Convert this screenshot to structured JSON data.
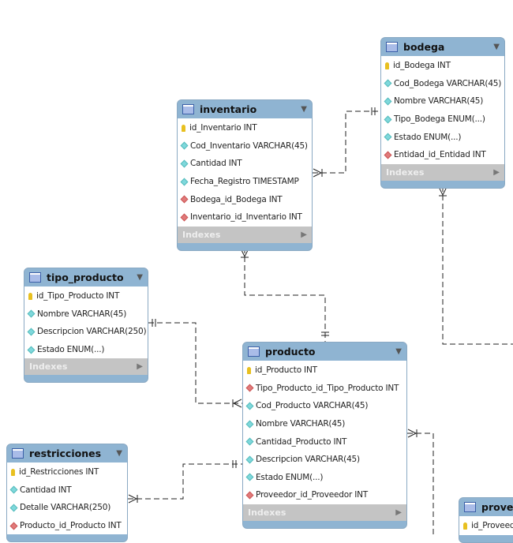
{
  "tables": {
    "bodega": {
      "name": "bodega",
      "columns": [
        {
          "text": "id_Bodega INT",
          "kind": "key"
        },
        {
          "text": "Cod_Bodega VARCHAR(45)",
          "kind": "attr"
        },
        {
          "text": "Nombre VARCHAR(45)",
          "kind": "attr"
        },
        {
          "text": "Tipo_Bodega ENUM(...)",
          "kind": "attr"
        },
        {
          "text": "Estado ENUM(...)",
          "kind": "attr"
        },
        {
          "text": "Entidad_id_Entidad INT",
          "kind": "fk"
        }
      ],
      "indexes": "Indexes"
    },
    "inventario": {
      "name": "inventario",
      "columns": [
        {
          "text": "id_Inventario INT",
          "kind": "key"
        },
        {
          "text": "Cod_Inventario VARCHAR(45)",
          "kind": "attr"
        },
        {
          "text": "Cantidad INT",
          "kind": "attr"
        },
        {
          "text": "Fecha_Registro TIMESTAMP",
          "kind": "attr"
        },
        {
          "text": "Bodega_id_Bodega INT",
          "kind": "fk"
        },
        {
          "text": "Inventario_id_Inventario INT",
          "kind": "fk"
        }
      ],
      "indexes": "Indexes"
    },
    "tipo_producto": {
      "name": "tipo_producto",
      "columns": [
        {
          "text": "id_Tipo_Producto INT",
          "kind": "key"
        },
        {
          "text": "Nombre VARCHAR(45)",
          "kind": "attr"
        },
        {
          "text": "Descripcion VARCHAR(250)",
          "kind": "attr"
        },
        {
          "text": "Estado ENUM(...)",
          "kind": "attr"
        }
      ],
      "indexes": "Indexes"
    },
    "producto": {
      "name": "producto",
      "columns": [
        {
          "text": "id_Producto INT",
          "kind": "key"
        },
        {
          "text": "Tipo_Producto_id_Tipo_Producto INT",
          "kind": "fk"
        },
        {
          "text": "Cod_Producto VARCHAR(45)",
          "kind": "attr"
        },
        {
          "text": "Nombre VARCHAR(45)",
          "kind": "attr"
        },
        {
          "text": "Cantidad_Producto INT",
          "kind": "attr"
        },
        {
          "text": "Descripcion VARCHAR(45)",
          "kind": "attr"
        },
        {
          "text": "Estado ENUM(...)",
          "kind": "attr"
        },
        {
          "text": "Proveedor_id_Proveedor INT",
          "kind": "fk"
        }
      ],
      "indexes": "Indexes"
    },
    "restricciones": {
      "name": "restricciones",
      "columns": [
        {
          "text": "id_Restricciones INT",
          "kind": "key"
        },
        {
          "text": "Cantidad INT",
          "kind": "attr"
        },
        {
          "text": "Detalle VARCHAR(250)",
          "kind": "attr"
        },
        {
          "text": "Producto_id_Producto INT",
          "kind": "fk"
        }
      ]
    },
    "proveedor": {
      "name": "proveedor",
      "columns": [
        {
          "text": "id_Proveedor INT",
          "kind": "key"
        }
      ]
    }
  },
  "colors": {
    "header": "#8fb4d2",
    "indexes": "#c4c4c4",
    "key": "#e8c020",
    "attr": "#7fd8dc",
    "fk": "#e07a7a"
  }
}
